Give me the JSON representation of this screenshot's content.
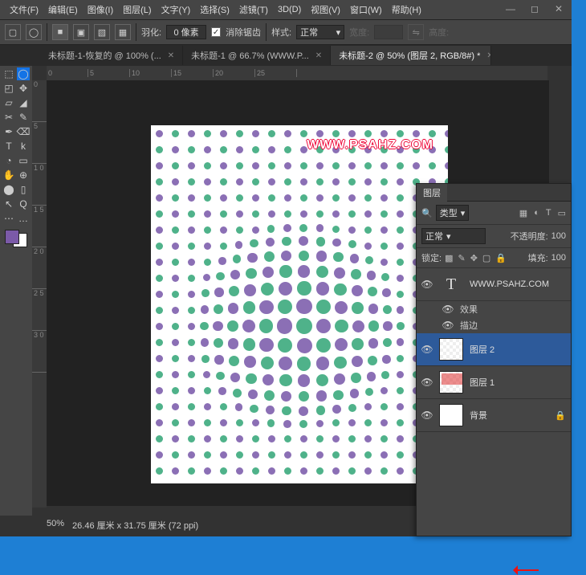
{
  "menu": [
    "文件(F)",
    "编辑(E)",
    "图像(I)",
    "图层(L)",
    "文字(Y)",
    "选择(S)",
    "滤镜(T)",
    "3D(D)",
    "视图(V)",
    "窗口(W)",
    "帮助(H)"
  ],
  "optbar": {
    "feather_label": "羽化:",
    "feather_value": "0 像素",
    "antialias": "消除锯齿",
    "style_label": "样式:",
    "style_value": "正常",
    "width_label": "宽度:",
    "height_label": "高度:"
  },
  "tabs": [
    {
      "label": "未标题-1-恢复的 @ 100% (...",
      "active": false
    },
    {
      "label": "未标题-1 @ 66.7% (WWW.P...",
      "active": false
    },
    {
      "label": "未标题-2 @ 50% (图层 2, RGB/8#) *",
      "active": true
    }
  ],
  "ruler_top": [
    "0",
    "5",
    "10",
    "15",
    "20",
    "25"
  ],
  "ruler_left": [
    "0",
    "5",
    "1 0",
    "1 5",
    "2 0",
    "2 5",
    "3 0"
  ],
  "watermark": "WWW.PSAHZ.COM",
  "status": {
    "zoom": "50%",
    "dims": "26.46 厘米 x 31.75 厘米 (72 ppi)"
  },
  "panel": {
    "title": "图层",
    "filter": "类型",
    "blend": "正常",
    "opacity_label": "不透明度:",
    "opacity_val": "100",
    "lock_label": "锁定:",
    "fill_label": "填充:",
    "fill_val": "100"
  },
  "layers": [
    {
      "type": "text",
      "label": "WWW.PSAHZ.COM",
      "sub": [
        "效果",
        "描边"
      ]
    },
    {
      "type": "img",
      "label": "图层 2",
      "selected": true
    },
    {
      "type": "img",
      "label": "图层 1",
      "deleted": true
    },
    {
      "type": "bg",
      "label": "背景"
    }
  ],
  "colors": {
    "purple": "#8b6fb5",
    "green": "#4fb28a"
  },
  "chart_data": null
}
